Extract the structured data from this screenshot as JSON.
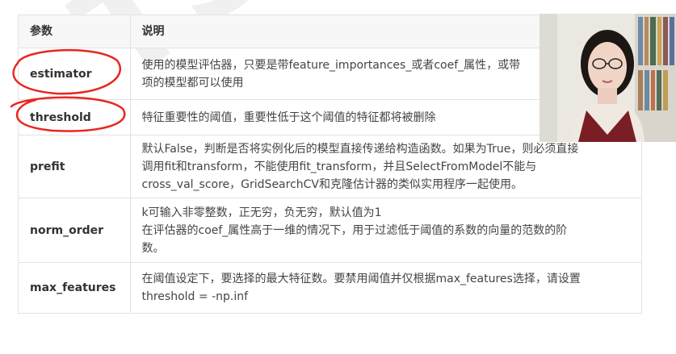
{
  "table": {
    "headers": {
      "param": "参数",
      "desc": "说明"
    },
    "rows": [
      {
        "param": "estimator",
        "desc_lines": [
          "使用的模型评估器，只要是带feature_importances_或者coef_属性，或带",
          "项的模型都可以使用"
        ]
      },
      {
        "param": "threshold",
        "desc_lines": [
          "特征重要性的阈值，重要性低于这个阈值的特征都将被删除"
        ]
      },
      {
        "param": "prefit",
        "desc_lines": [
          "默认False，判断是否将实例化后的模型直接传递给构造函数。如果为True，则必须直接",
          "调用fit和transform，不能使用fit_transform，并且SelectFromModel不能与",
          "cross_val_score，GridSearchCV和克隆估计器的类似实用程序一起使用。"
        ]
      },
      {
        "param": "norm_order",
        "desc_lines": [
          "k可输入非零整数，正无穷，负无穷，默认值为1",
          "在评估器的coef_属性高于一维的情况下，用于过滤低于阈值的系数的向量的范数的阶",
          "数。"
        ]
      },
      {
        "param": "max_features",
        "desc_lines": [
          "在阈值设定下，要选择的最大特征数。要禁用阈值并仅根据max_features选择，请设置",
          "threshold = -np.inf"
        ]
      }
    ]
  },
  "watermark": "TS",
  "colors": {
    "annotation": "#e8261f",
    "header_bg": "#f7f7f7",
    "border": "#e3e3e3"
  }
}
